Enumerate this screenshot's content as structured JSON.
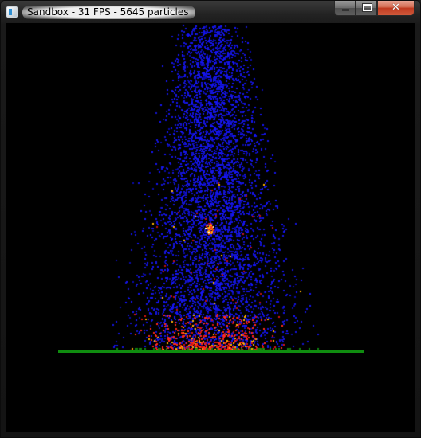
{
  "window": {
    "title": "Sandbox - 31 FPS - 5645 particles",
    "app_icon": "window-icon"
  },
  "caption_buttons": {
    "minimize_icon": "minimize-icon",
    "maximize_icon": "maximize-icon",
    "close_icon": "close-icon"
  },
  "simulation": {
    "background_color": "#000000",
    "ground_color": "#0f8c0f",
    "particle_colors": {
      "water": "#1a1ae6",
      "fire": "#ff2a1a",
      "ember": "#ffb000",
      "spark": "#ffffff"
    }
  }
}
